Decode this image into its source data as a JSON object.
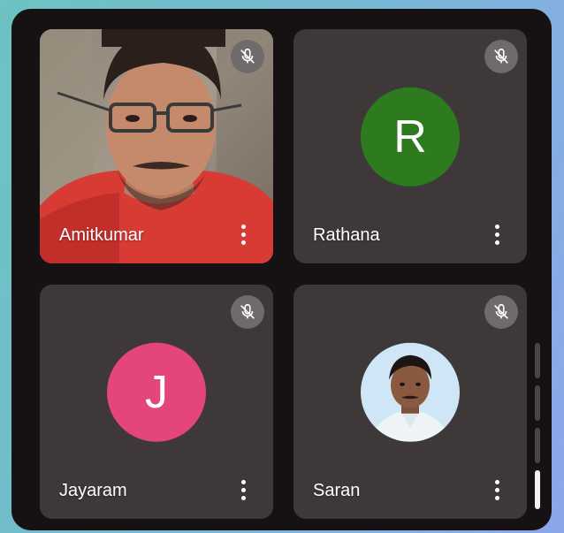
{
  "participants": [
    {
      "name": "Amitkumar",
      "muted": true,
      "display": "video"
    },
    {
      "name": "Rathana",
      "muted": true,
      "display": "initial",
      "initial": "R",
      "avatar_color": "#2e7a1f"
    },
    {
      "name": "Jayaram",
      "muted": true,
      "display": "initial",
      "initial": "J",
      "avatar_color": "#e4457a"
    },
    {
      "name": "Saran",
      "muted": true,
      "display": "photo"
    }
  ],
  "icons": {
    "mute": "mic-off-icon",
    "more": "more-vertical-icon"
  },
  "colors": {
    "tile_background": "#3e3839",
    "frame_background": "#161213",
    "mute_badge": "#6f6a6b"
  }
}
